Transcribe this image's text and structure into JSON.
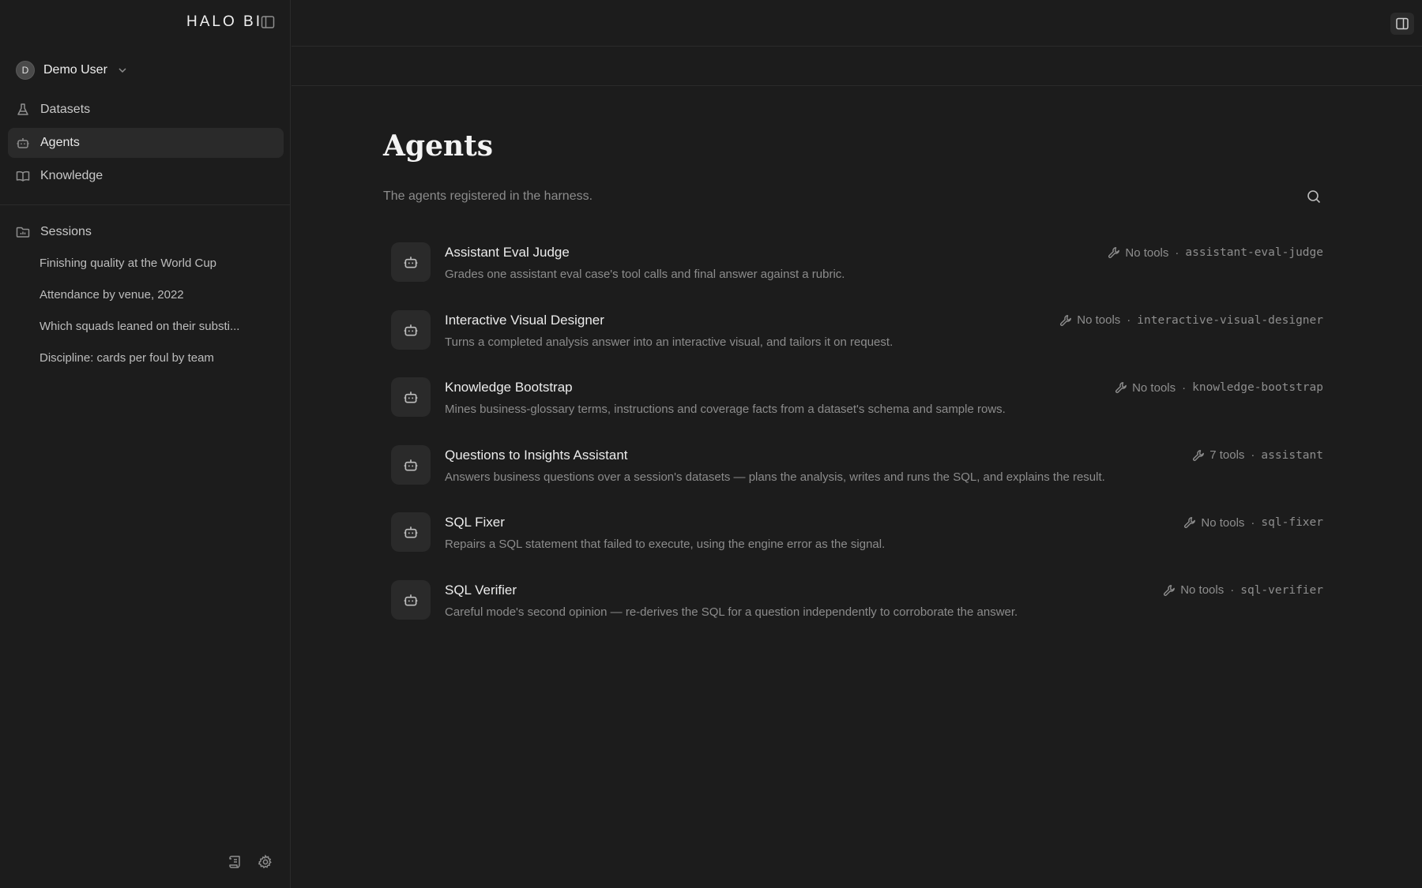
{
  "app": {
    "brand": "HALO BI"
  },
  "user": {
    "initial": "D",
    "name": "Demo User"
  },
  "nav": {
    "items": [
      {
        "label": "Datasets",
        "icon": "flask-icon",
        "active": false
      },
      {
        "label": "Agents",
        "icon": "robot-icon",
        "active": true
      },
      {
        "label": "Knowledge",
        "icon": "book-icon",
        "active": false
      }
    ]
  },
  "sessions": {
    "label": "Sessions",
    "items": [
      "Finishing quality at the World Cup",
      "Attendance by venue, 2022",
      "Which squads leaned on their substi...",
      "Discipline: cards per foul by team"
    ]
  },
  "page": {
    "title": "Agents",
    "subtitle": "The agents registered in the harness."
  },
  "agents": [
    {
      "name": "Assistant Eval Judge",
      "description": "Grades one assistant eval case's tool calls and final answer against a rubric.",
      "tools": "No tools",
      "slug": "assistant-eval-judge"
    },
    {
      "name": "Interactive Visual Designer",
      "description": "Turns a completed analysis answer into an interactive visual, and tailors it on request.",
      "tools": "No tools",
      "slug": "interactive-visual-designer"
    },
    {
      "name": "Knowledge Bootstrap",
      "description": "Mines business-glossary terms, instructions and coverage facts from a dataset's schema and sample rows.",
      "tools": "No tools",
      "slug": "knowledge-bootstrap"
    },
    {
      "name": "Questions to Insights Assistant",
      "description": "Answers business questions over a session's datasets — plans the analysis, writes and runs the SQL, and explains the result.",
      "tools": "7 tools",
      "slug": "assistant"
    },
    {
      "name": "SQL Fixer",
      "description": "Repairs a SQL statement that failed to execute, using the engine error as the signal.",
      "tools": "No tools",
      "slug": "sql-fixer"
    },
    {
      "name": "SQL Verifier",
      "description": "Careful mode's second opinion — re-derives the SQL for a question independently to corroborate the answer.",
      "tools": "No tools",
      "slug": "sql-verifier"
    }
  ],
  "meta_separator": "·"
}
